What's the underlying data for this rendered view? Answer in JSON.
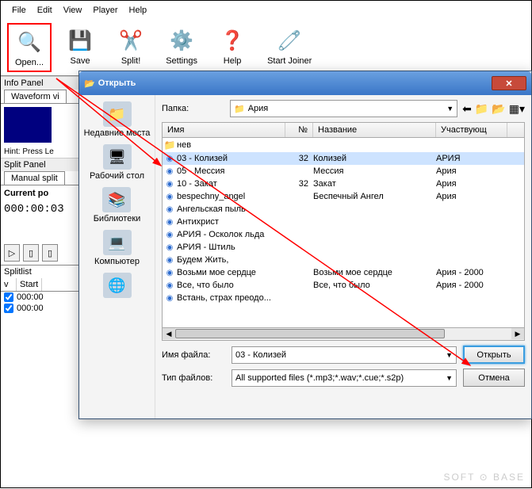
{
  "menu": [
    "File",
    "Edit",
    "View",
    "Player",
    "Help"
  ],
  "toolbar": [
    {
      "label": "Open...",
      "icon": "🔍"
    },
    {
      "label": "Save",
      "icon": "💾"
    },
    {
      "label": "Split!",
      "icon": "✂️"
    },
    {
      "label": "Settings",
      "icon": "⚙️"
    },
    {
      "label": "Help",
      "icon": "❓"
    },
    {
      "label": "Start Joiner",
      "icon": "🧷"
    }
  ],
  "panels": {
    "info_label": "Info Panel",
    "waveform_tab": "Waveform vi",
    "hint": "Hint: Press Le",
    "split_label": "Split Panel",
    "manual_tab": "Manual split",
    "current_pos": "Current po",
    "time": "000:00:03",
    "splitlist_label": "Splitlist",
    "split_head": {
      "v": "v",
      "start": "Start"
    },
    "split_rows": [
      "000:00",
      "000:00"
    ]
  },
  "dialog": {
    "title": "Открыть",
    "folder_label": "Папка:",
    "folder_value": "Ария",
    "columns": {
      "name": "Имя",
      "num": "№",
      "title": "Название",
      "artist": "Участвующ"
    },
    "files": [
      {
        "type": "folder",
        "name": "нев"
      },
      {
        "type": "file",
        "name": "03 - Колизей",
        "num": "32",
        "title": "Колизей",
        "artist": "АРИЯ",
        "selected": true
      },
      {
        "type": "file",
        "name": "05 - Мессия",
        "title": "Мессия",
        "artist": "Ария"
      },
      {
        "type": "file",
        "name": "10 - Закат",
        "num": "32",
        "title": "Закат",
        "artist": "Ария"
      },
      {
        "type": "file",
        "name": "bespechny_angel",
        "title": "Беспечный Ангел",
        "artist": "Ария"
      },
      {
        "type": "file",
        "name": "Ангельская пыль"
      },
      {
        "type": "file",
        "name": "Антихрист"
      },
      {
        "type": "file",
        "name": "АРИЯ - Осколок льда"
      },
      {
        "type": "file",
        "name": "АРИЯ - Штиль"
      },
      {
        "type": "file",
        "name": "Будем Жить,"
      },
      {
        "type": "file",
        "name": "Возьми мое сердце",
        "title": "Возьми мое сердце",
        "artist": "Ария - 2000"
      },
      {
        "type": "file",
        "name": "Все, что было",
        "title": "Все, что было",
        "artist": "Ария - 2000"
      },
      {
        "type": "file",
        "name": "Встань, страх преодо..."
      }
    ],
    "sidebar": [
      {
        "label": "Недавние места",
        "icon": "📁"
      },
      {
        "label": "Рабочий стол",
        "icon": "🖥"
      },
      {
        "label": "Библиотеки",
        "icon": "📚"
      },
      {
        "label": "Компьютер",
        "icon": "💻"
      },
      {
        "label": "",
        "icon": "🌐"
      }
    ],
    "filename_label": "Имя файла:",
    "filename_value": "03 - Колизей",
    "filetype_label": "Тип файлов:",
    "filetype_value": "All supported files (*.mp3;*.wav;*.cue;*.s2p)",
    "open_btn": "Открыть",
    "cancel_btn": "Отмена"
  },
  "watermark": "SOFT ⊙ BASE"
}
